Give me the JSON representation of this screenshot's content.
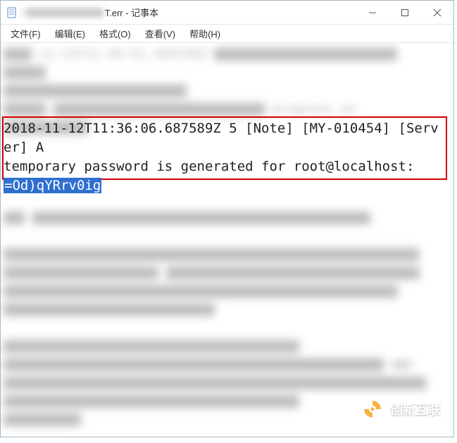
{
  "titlebar": {
    "blurred_prefix": "I",
    "title_suffix": "T.err - 记事本"
  },
  "menubar": {
    "file": "文件(F)",
    "edit": "编辑(E)",
    "format": "格式(O)",
    "view": "查看(V)",
    "help": "帮助(H)"
  },
  "highlighted_text": {
    "line1": "2018-11-12T11:36:06.687589Z 5 [Note] [MY-010454] [Server] A",
    "line2": "temporary password is generated for root@localhost:",
    "selected_password": "=Od)qYRrv0ig"
  },
  "watermark": {
    "text": "创新互联"
  },
  "top_blur_fragments": [
    "11-12T11:35:51.404236Z",
    "progress as"
  ]
}
